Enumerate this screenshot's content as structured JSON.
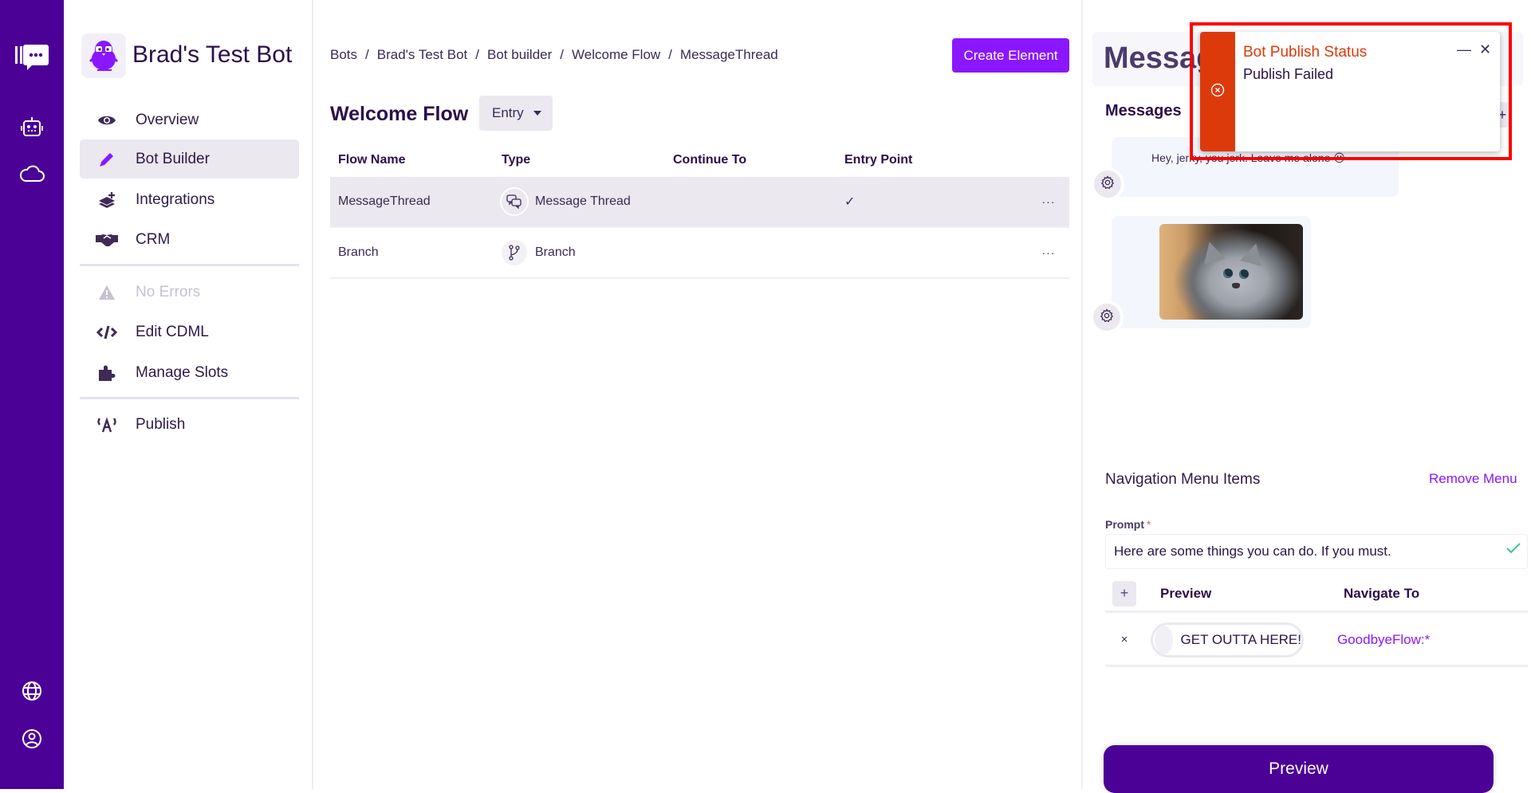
{
  "rail": {
    "icons": [
      "app-logo-icon",
      "bots-icon",
      "cloud-icon",
      "globe-icon",
      "user-account-icon"
    ]
  },
  "bot": {
    "name": "Brad's Test Bot"
  },
  "sidebar": {
    "items": [
      {
        "label": "Overview",
        "icon": "eye-icon"
      },
      {
        "label": "Bot Builder",
        "icon": "pencil-icon",
        "active": true
      },
      {
        "label": "Integrations",
        "icon": "layers-plus-icon"
      },
      {
        "label": "CRM",
        "icon": "handshake-icon"
      },
      {
        "label": "No Errors",
        "icon": "warning-icon",
        "disabled": true
      },
      {
        "label": "Edit CDML",
        "icon": "code-icon"
      },
      {
        "label": "Manage Slots",
        "icon": "puzzle-icon"
      },
      {
        "label": "Publish",
        "icon": "broadcast-icon"
      }
    ]
  },
  "breadcrumb": [
    "Bots",
    "Brad's Test Bot",
    "Bot builder",
    "Welcome Flow",
    "MessageThread"
  ],
  "breadcrumb_sep": "/",
  "toolbar": {
    "create_element_label": "Create Element"
  },
  "flow": {
    "title": "Welcome Flow",
    "type_dropdown": "Entry"
  },
  "table": {
    "headers": [
      "Flow Name",
      "Type",
      "Continue To",
      "Entry Point"
    ],
    "rows": [
      {
        "name": "MessageThread",
        "type": "Message Thread",
        "type_icon": "message-thread-icon",
        "continue_to": "",
        "entry_point": "✓",
        "actions": "···",
        "selected": true
      },
      {
        "name": "Branch",
        "type": "Branch",
        "type_icon": "branch-icon",
        "continue_to": "",
        "entry_point": "",
        "actions": "···",
        "selected": false
      }
    ]
  },
  "right_panel": {
    "title": "MessageThread",
    "messages_label": "Messages",
    "add_message": "+",
    "messages": [
      {
        "type": "text",
        "text": "Hey, jerky, you jerk. Leave me alone 😐"
      },
      {
        "type": "image",
        "alt": "sad gray kitten photo"
      }
    ],
    "nav_menu": {
      "title": "Navigation Menu Items",
      "remove_label": "Remove Menu",
      "prompt_label": "Prompt",
      "prompt_required": "*",
      "prompt_value": "Here are some things you can do. If you must.",
      "add_label": "+",
      "headers": [
        "Preview",
        "Navigate To"
      ],
      "items": [
        {
          "remove": "×",
          "preview": "GET OUTTA HERE!",
          "navigate_to": "GoodbyeFlow:*"
        }
      ]
    },
    "preview_button": "Preview"
  },
  "toast": {
    "title": "Bot Publish Status",
    "message": "Publish Failed",
    "minimize": "—",
    "close": "✕",
    "status_color": "#dd3a0c"
  },
  "colors": {
    "brand_dark": "#4b0096",
    "accent": "#8a17ff",
    "error": "#dd3a0c",
    "success": "#3cc48e"
  }
}
